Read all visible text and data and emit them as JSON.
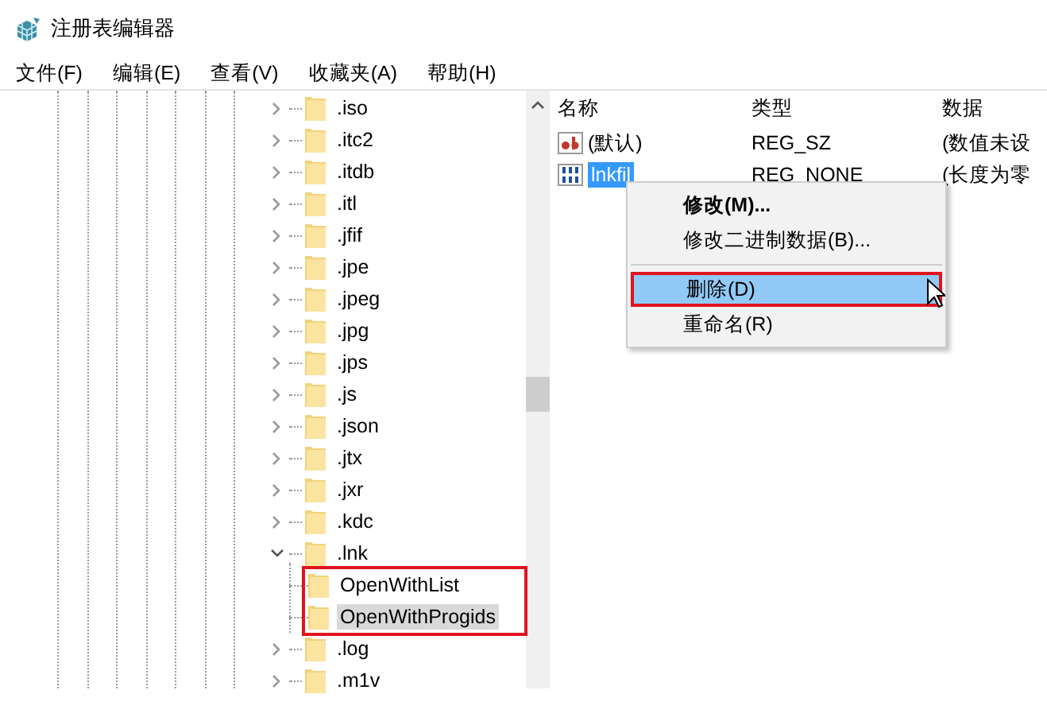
{
  "window": {
    "title": "注册表编辑器"
  },
  "menu_bar": [
    "文件(F)",
    "编辑(E)",
    "查看(V)",
    "收藏夹(A)",
    "帮助(H)"
  ],
  "tree": {
    "items": [
      {
        "label": ".iso",
        "expanded": false,
        "selected": false
      },
      {
        "label": ".itc2",
        "expanded": false,
        "selected": false
      },
      {
        "label": ".itdb",
        "expanded": false,
        "selected": false
      },
      {
        "label": ".itl",
        "expanded": false,
        "selected": false
      },
      {
        "label": ".jfif",
        "expanded": false,
        "selected": false
      },
      {
        "label": ".jpe",
        "expanded": false,
        "selected": false
      },
      {
        "label": ".jpeg",
        "expanded": false,
        "selected": false
      },
      {
        "label": ".jpg",
        "expanded": false,
        "selected": false
      },
      {
        "label": ".jps",
        "expanded": false,
        "selected": false
      },
      {
        "label": ".js",
        "expanded": false,
        "selected": false
      },
      {
        "label": ".json",
        "expanded": false,
        "selected": false
      },
      {
        "label": ".jtx",
        "expanded": false,
        "selected": false
      },
      {
        "label": ".jxr",
        "expanded": false,
        "selected": false
      },
      {
        "label": ".kdc",
        "expanded": false,
        "selected": false
      },
      {
        "label": ".lnk",
        "expanded": true,
        "selected": false,
        "children_callout": true,
        "children": [
          {
            "label": "OpenWithList",
            "selected": false
          },
          {
            "label": "OpenWithProgids",
            "selected": true
          }
        ]
      },
      {
        "label": ".log",
        "expanded": false,
        "selected": false
      },
      {
        "label": ".m1v",
        "expanded": false,
        "selected": false
      }
    ]
  },
  "values": {
    "columns": [
      "名称",
      "类型",
      "数据"
    ],
    "rows": [
      {
        "kind": "string",
        "name": "(默认)",
        "type": "REG_SZ",
        "data": "(数值未设",
        "selected": false
      },
      {
        "kind": "binary",
        "name": "lnkfil",
        "type": "REG_NONE",
        "data": "(长度为零",
        "selected": true
      }
    ]
  },
  "context_menu": {
    "items": [
      {
        "kind": "item",
        "label": "修改(M)...",
        "default": true,
        "selected": false,
        "callout": false
      },
      {
        "kind": "item",
        "label": "修改二进制数据(B)...",
        "default": false,
        "selected": false,
        "callout": false
      },
      {
        "kind": "separator"
      },
      {
        "kind": "item",
        "label": "删除(D)",
        "default": false,
        "selected": true,
        "callout": true
      },
      {
        "kind": "item",
        "label": "重命名(R)",
        "default": false,
        "selected": false,
        "callout": false
      }
    ]
  }
}
